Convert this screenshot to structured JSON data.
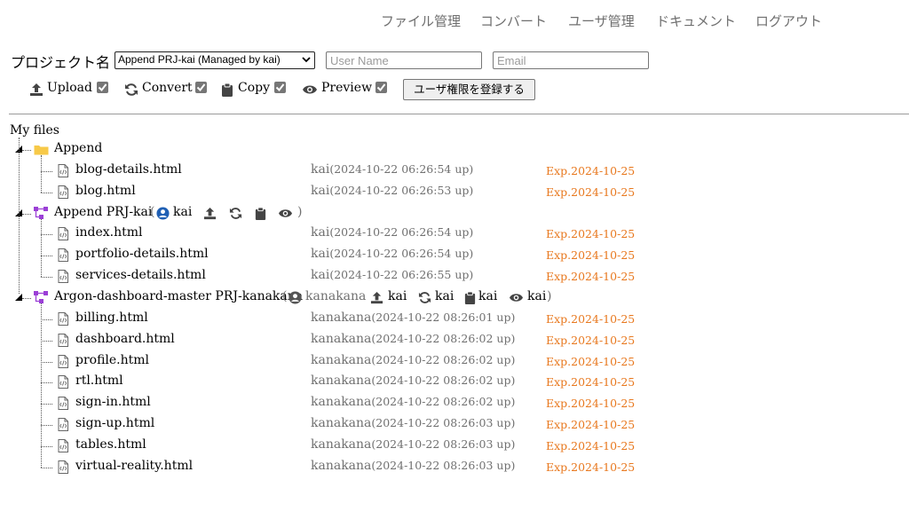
{
  "nav": {
    "file_management": "ファイル管理",
    "convert": "コンバート",
    "user_management": "ユーザ管理",
    "documents": "ドキュメント",
    "logout": "ログアウト"
  },
  "project": {
    "label": "プロジェクト名",
    "selected": "Append PRJ-kai (Managed by kai)",
    "username_placeholder": "User Name",
    "email_placeholder": "Email"
  },
  "permissions": {
    "upload": "Upload",
    "convert": "Convert",
    "copy": "Copy",
    "preview": "Preview",
    "register_button": "ユーザ権限を登録する"
  },
  "tree": {
    "title": "My files",
    "folders": [
      {
        "name": "Append",
        "files": [
          {
            "name": "blog-details.html",
            "owner": "kai",
            "ts": "(2024-10-22 06:26:54 up)",
            "exp": "Exp.2024-10-25"
          },
          {
            "name": "blog.html",
            "owner": "kai",
            "ts": "(2024-10-22 06:26:53 up)",
            "exp": "Exp.2024-10-25"
          }
        ]
      },
      {
        "name": "Append PRJ-kai",
        "open_paren": "(",
        "close_paren": ")",
        "manager": "kai",
        "files": [
          {
            "name": "index.html",
            "owner": "kai",
            "ts": "(2024-10-22 06:26:54 up)",
            "exp": "Exp.2024-10-25"
          },
          {
            "name": "portfolio-details.html",
            "owner": "kai",
            "ts": "(2024-10-22 06:26:54 up)",
            "exp": "Exp.2024-10-25"
          },
          {
            "name": "services-details.html",
            "owner": "kai",
            "ts": "(2024-10-22 06:26:55 up)",
            "exp": "Exp.2024-10-25"
          }
        ]
      },
      {
        "name": "Argon-dashboard-master PRJ-kanakana",
        "open_paren": "(",
        "close_paren": ")",
        "manager": "kanakana",
        "perm_users": {
          "upload": "kai",
          "convert": "kai",
          "copy": "kai",
          "preview": "kai"
        },
        "files": [
          {
            "name": "billing.html",
            "owner": "kanakana",
            "ts": "(2024-10-22 08:26:01 up)",
            "exp": "Exp.2024-10-25"
          },
          {
            "name": "dashboard.html",
            "owner": "kanakana",
            "ts": "(2024-10-22 08:26:02 up)",
            "exp": "Exp.2024-10-25"
          },
          {
            "name": "profile.html",
            "owner": "kanakana",
            "ts": "(2024-10-22 08:26:02 up)",
            "exp": "Exp.2024-10-25"
          },
          {
            "name": "rtl.html",
            "owner": "kanakana",
            "ts": "(2024-10-22 08:26:02 up)",
            "exp": "Exp.2024-10-25"
          },
          {
            "name": "sign-in.html",
            "owner": "kanakana",
            "ts": "(2024-10-22 08:26:02 up)",
            "exp": "Exp.2024-10-25"
          },
          {
            "name": "sign-up.html",
            "owner": "kanakana",
            "ts": "(2024-10-22 08:26:03 up)",
            "exp": "Exp.2024-10-25"
          },
          {
            "name": "tables.html",
            "owner": "kanakana",
            "ts": "(2024-10-22 08:26:03 up)",
            "exp": "Exp.2024-10-25"
          },
          {
            "name": "virtual-reality.html",
            "owner": "kanakana",
            "ts": "(2024-10-22 08:26:03 up)",
            "exp": "Exp.2024-10-25"
          }
        ]
      }
    ]
  },
  "colors": {
    "nav_text": "#6f6f6f",
    "owner_text": "#707070",
    "expiry": "#e8781e",
    "folder": "#f7c948",
    "project_icon": "#9b3fd6",
    "user_icon": "#1f5fb4"
  },
  "icons": {
    "upload": "upload-icon",
    "convert": "refresh-icon",
    "copy": "clipboard-icon",
    "preview": "eye-icon",
    "folder": "folder-icon",
    "file": "html-file-icon",
    "project": "project-tree-icon",
    "user": "user-circle-icon"
  }
}
